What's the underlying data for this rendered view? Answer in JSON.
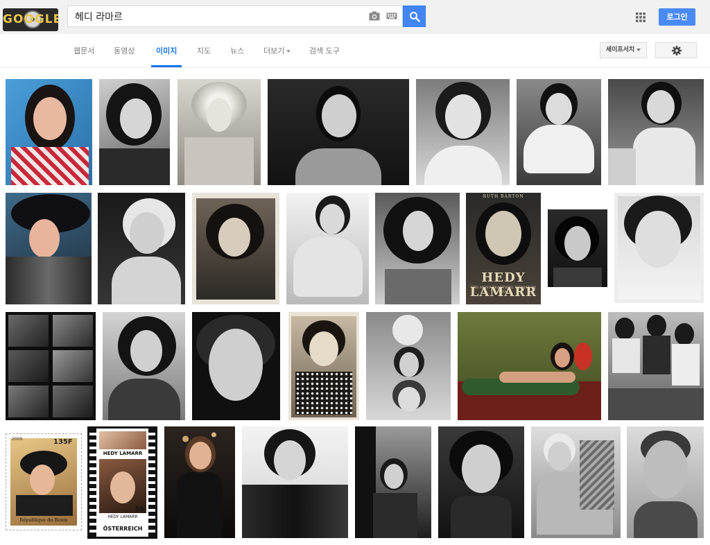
{
  "search": {
    "query": "헤디 라마르"
  },
  "header": {
    "login_label": "로그인"
  },
  "logo": {
    "text": "GOOGLE"
  },
  "tabs": [
    {
      "label": "웹문서",
      "active": false,
      "has_caret": false
    },
    {
      "label": "동영상",
      "active": false,
      "has_caret": false
    },
    {
      "label": "이미지",
      "active": true,
      "has_caret": false
    },
    {
      "label": "지도",
      "active": false,
      "has_caret": false
    },
    {
      "label": "뉴스",
      "active": false,
      "has_caret": false
    },
    {
      "label": "더보기",
      "active": false,
      "has_caret": true
    },
    {
      "label": "검색 도구",
      "active": false,
      "has_caret": false
    }
  ],
  "toolbar": {
    "safesearch_label": "세이프서치"
  },
  "icons": {
    "camera": "camera-icon",
    "keyboard": "keyboard-icon",
    "search": "search-icon",
    "apps": "apps-grid-icon",
    "settings": "gear-icon"
  },
  "colors": {
    "accent": "#4285f4",
    "active_tab": "#1a73e8",
    "login": "#4a8af4"
  },
  "image_captions": {
    "book_author": "RUTH BARTON",
    "book_title": "HEDY LAMARR",
    "book_subtitle": "THE MOST BEAUTIFUL WOMAN IN FILM",
    "stamp1_year": "2009",
    "stamp1_value": "135F",
    "stamp1_country": "République du Benin",
    "stamp2_name_top": "HEDY LAMARR",
    "stamp2_name_bottom": "HEDY LAMARR",
    "stamp2_value": "55",
    "stamp2_country": "ÖSTERREICH"
  },
  "images": [
    {
      "id": "r1-1",
      "tone": "color-red"
    },
    {
      "id": "r1-2",
      "tone": "bw-dark"
    },
    {
      "id": "r1-3",
      "tone": "bw-light"
    },
    {
      "id": "r1-4",
      "tone": "bw-dark"
    },
    {
      "id": "r1-5",
      "tone": "bw-light"
    },
    {
      "id": "r1-6",
      "tone": "bw-light"
    },
    {
      "id": "r1-7",
      "tone": "bw-dark"
    },
    {
      "id": "r2-1",
      "tone": "color-dark"
    },
    {
      "id": "r2-2",
      "tone": "bw-dark"
    },
    {
      "id": "r2-3",
      "tone": "bw-sepia"
    },
    {
      "id": "r2-4",
      "tone": "bw-light"
    },
    {
      "id": "r2-5",
      "tone": "bw-dark"
    },
    {
      "id": "r2-6",
      "tone": "book"
    },
    {
      "id": "r2-7",
      "tone": "bw-dark"
    },
    {
      "id": "r2-8",
      "tone": "bw-light"
    },
    {
      "id": "r3-1",
      "tone": "contact-sheet"
    },
    {
      "id": "r3-2",
      "tone": "bw-dark"
    },
    {
      "id": "r3-3",
      "tone": "bw-dark"
    },
    {
      "id": "r3-4",
      "tone": "bw-sepia"
    },
    {
      "id": "r3-5",
      "tone": "bw-light"
    },
    {
      "id": "r3-6",
      "tone": "color-green"
    },
    {
      "id": "r3-7",
      "tone": "bw-light"
    },
    {
      "id": "r4-1",
      "tone": "stamp"
    },
    {
      "id": "r4-2",
      "tone": "stamp-film"
    },
    {
      "id": "r4-3",
      "tone": "color-dark"
    },
    {
      "id": "r4-4",
      "tone": "bw-light"
    },
    {
      "id": "r4-5",
      "tone": "bw-dark"
    },
    {
      "id": "r4-6",
      "tone": "bw-dark"
    },
    {
      "id": "r4-7",
      "tone": "bw-light"
    },
    {
      "id": "r4-8",
      "tone": "bw-light"
    }
  ]
}
